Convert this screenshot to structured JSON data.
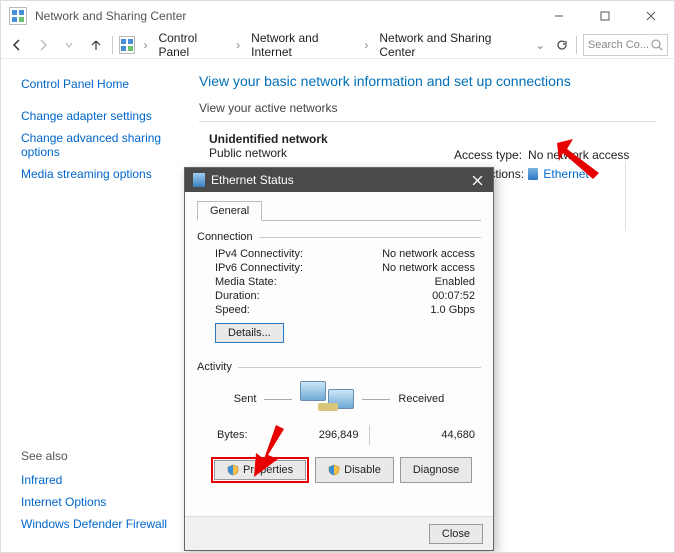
{
  "window": {
    "title": "Network and Sharing Center"
  },
  "breadcrumb": {
    "items": [
      "Control Panel",
      "Network and Internet",
      "Network and Sharing Center"
    ]
  },
  "search": {
    "placeholder": "Search Co..."
  },
  "sidebar": {
    "home": "Control Panel Home",
    "links": [
      "Change adapter settings",
      "Change advanced sharing options",
      "Media streaming options"
    ],
    "seealso_label": "See also",
    "seealso": [
      "Infrared",
      "Internet Options",
      "Windows Defender Firewall"
    ]
  },
  "main": {
    "heading": "View your basic network information and set up connections",
    "active_label": "View your active networks",
    "network": {
      "name": "Unidentified network",
      "type": "Public network"
    },
    "right": {
      "access_label": "Access type:",
      "access_value": "No network access",
      "conn_label": "Connections:",
      "conn_value": "Ethernet"
    }
  },
  "dialog": {
    "title": "Ethernet Status",
    "tab": "General",
    "group_conn": "Connection",
    "rows": {
      "ipv4_label": "IPv4 Connectivity:",
      "ipv4_value": "No network access",
      "ipv6_label": "IPv6 Connectivity:",
      "ipv6_value": "No network access",
      "media_label": "Media State:",
      "media_value": "Enabled",
      "dur_label": "Duration:",
      "dur_value": "00:07:52",
      "speed_label": "Speed:",
      "speed_value": "1.0 Gbps"
    },
    "details_btn": "Details...",
    "group_act": "Activity",
    "sent_label": "Sent",
    "recv_label": "Received",
    "bytes_label": "Bytes:",
    "bytes_sent": "296,849",
    "bytes_recv": "44,680",
    "btn_properties": "Properties",
    "btn_disable": "Disable",
    "btn_diagnose": "Diagnose",
    "btn_close": "Close"
  }
}
